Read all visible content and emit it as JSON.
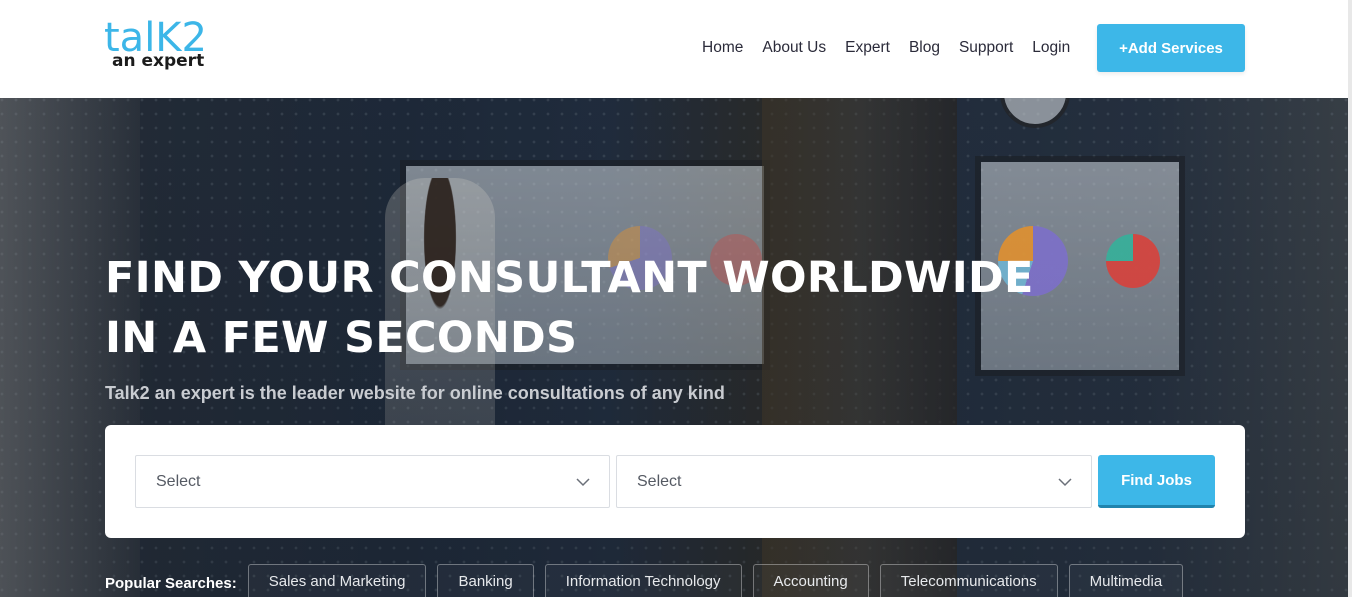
{
  "header": {
    "logo": {
      "top": "talK2",
      "bottom": "an expert"
    },
    "nav": [
      "Home",
      "About Us",
      "Expert",
      "Blog",
      "Support",
      "Login"
    ],
    "add_services_label": "+Add Services"
  },
  "hero": {
    "headline_line1": "FIND YOUR CONSULTANT WORLDWIDE",
    "headline_line2": "IN A FEW SECONDS",
    "subline": "Talk2 an expert is the leader website for online consultations of any kind"
  },
  "search": {
    "select1_value": "Select",
    "select2_value": "Select",
    "find_label": "Find Jobs"
  },
  "popular": {
    "label": "Popular Searches:",
    "tags": [
      "Sales and Marketing",
      "Banking",
      "Information Technology",
      "Accounting",
      "Telecommunications",
      "Multimedia"
    ]
  },
  "colors": {
    "accent": "#3db7e8",
    "text_dark": "#2b2b3a"
  }
}
